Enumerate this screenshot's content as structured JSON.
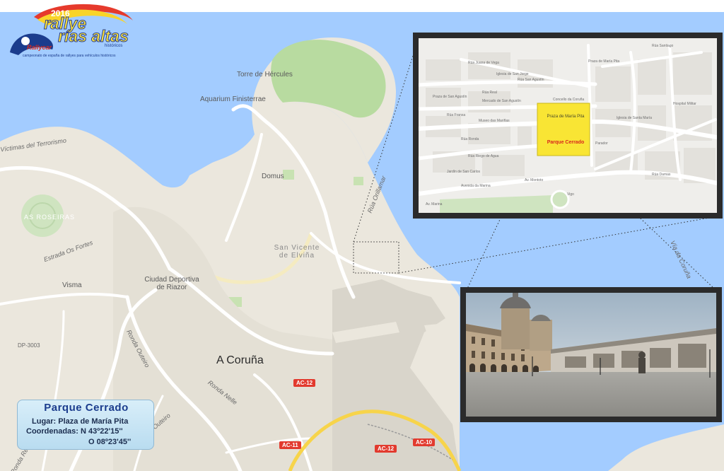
{
  "logo": {
    "year": "2016",
    "title_line1": "rallye",
    "title_line2": "rías altas",
    "subtitle": "históricos",
    "brand": "Rallycar",
    "tagline": "campeonato de españa de rallyes para vehículos históricos"
  },
  "map": {
    "city": "A Coruña",
    "district": "San Vicente de Elviña",
    "places": {
      "torre": "Torre de Hércules",
      "aquarium": "Aquarium Finisterrae",
      "domus": "Domus",
      "estadio": "Ciudad Deportiva de Riazor",
      "visma": "Visma",
      "as_roseiras": "AS ROSEIRAS",
      "terrorismo": "Víctimas del Terrorismo"
    },
    "streets": {
      "orillamar": "Rúa Orillamar",
      "fortes": "Estrada Os Fortes",
      "outeiro1": "Ronda Outeiro",
      "outeiro2": "Ronda Outeiro",
      "nelle": "Ronda Nelle",
      "real_club": "Ronda Real Club",
      "coruna": "Vía da Coruña"
    },
    "highways": {
      "dp3003": "DP-3003",
      "ac12a": "AC-12",
      "ac12b": "AC-12",
      "ac11": "AC-11",
      "ac10": "AC-10"
    }
  },
  "info": {
    "title": "Parque Cerrado",
    "lugar": "Lugar: Plaza de María Pita",
    "coord_n": "Coordenadas: N 43º22'15''",
    "coord_o": "O 08º23'45''"
  },
  "inset": {
    "square_name": "Praza de María Pita",
    "parque": "Parque Cerrado",
    "streets": {
      "ronda": "Rúa Ronda",
      "franxa": "Rúa Franxa",
      "real": "Rúa Real",
      "riego": "Rúa Riego de Agua",
      "marina": "Avenida da Marina",
      "montoto": "Av. Montoto",
      "marina2": "Av. Marina",
      "damas": "Rúa Damas",
      "santiago": "Rúa Santiago",
      "sanagustin": "Rúa San Agustín",
      "juana": "Rúa Juana de Vega",
      "praza": "Praza de San Agustín",
      "maria": "Praza de María Pita"
    },
    "pois": {
      "concello": "Concello da Coruña",
      "sanjorge": "Iglesia de San Jorge",
      "mercado": "Mercado de San Agustín",
      "museo": "Museo das Mariñas",
      "jardin": "Jardín de San Carlos",
      "parador": "Parador",
      "hospital": "Hospital Militar",
      "iglesia": "Iglesia de Santa María",
      "vigo": "Vigo"
    }
  },
  "colors": {
    "sea": "#a3ccff",
    "land": "#ebe7dd",
    "park": "#b8dba0",
    "parque_box": "#f9e534",
    "accent_red": "#d8261d",
    "navy": "#1b3c8d"
  }
}
